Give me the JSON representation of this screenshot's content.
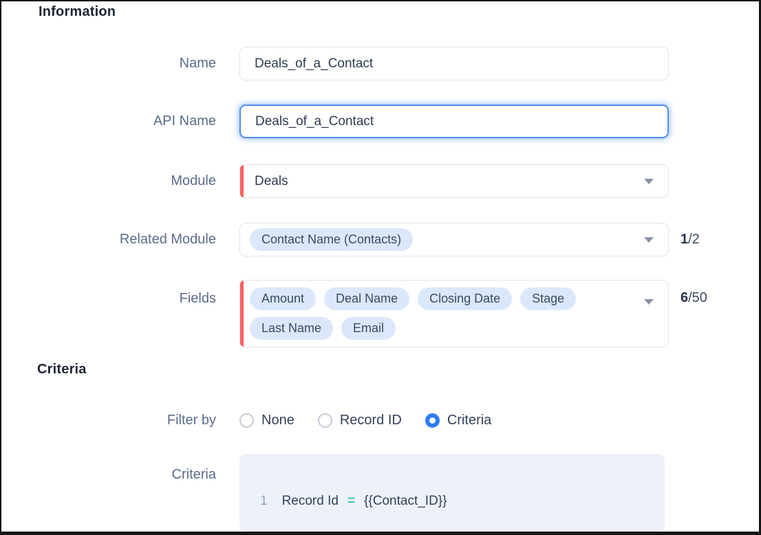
{
  "sections": {
    "information_title": "Information",
    "criteria_title": "Criteria"
  },
  "form": {
    "name": {
      "label": "Name",
      "value": "Deals_of_a_Contact"
    },
    "api_name": {
      "label": "API Name",
      "value": "Deals_of_a_Contact"
    },
    "module": {
      "label": "Module",
      "value": "Deals"
    },
    "related_module": {
      "label": "Related Module",
      "selected_chip": "Contact Name (Contacts)",
      "counter_current": "1",
      "counter_suffix": "/2"
    },
    "fields": {
      "label": "Fields",
      "chips": [
        "Amount",
        "Deal Name",
        "Closing Date",
        "Stage",
        "Last Name",
        "Email"
      ],
      "counter_current": "6",
      "counter_suffix": "/50"
    },
    "filter_by": {
      "label": "Filter by",
      "options": [
        {
          "label": "None",
          "selected": false
        },
        {
          "label": "Record ID",
          "selected": false
        },
        {
          "label": "Criteria",
          "selected": true
        }
      ]
    },
    "criteria_editor": {
      "label": "Criteria",
      "line_number": "1",
      "field": "Record Id",
      "operator": "=",
      "value": "{{Contact_ID}}"
    }
  },
  "icons": {
    "dropdown_arrow": "chevron-down-icon"
  },
  "colors": {
    "required_bar": "#ff6161",
    "focus_border": "#4f8ff7",
    "chip_background": "#dbe8fb",
    "radio_selected": "#2f7cf6",
    "operator_teal": "#49c5ac",
    "editor_background": "#edf1fa",
    "label_text": "#5a6b8c"
  }
}
